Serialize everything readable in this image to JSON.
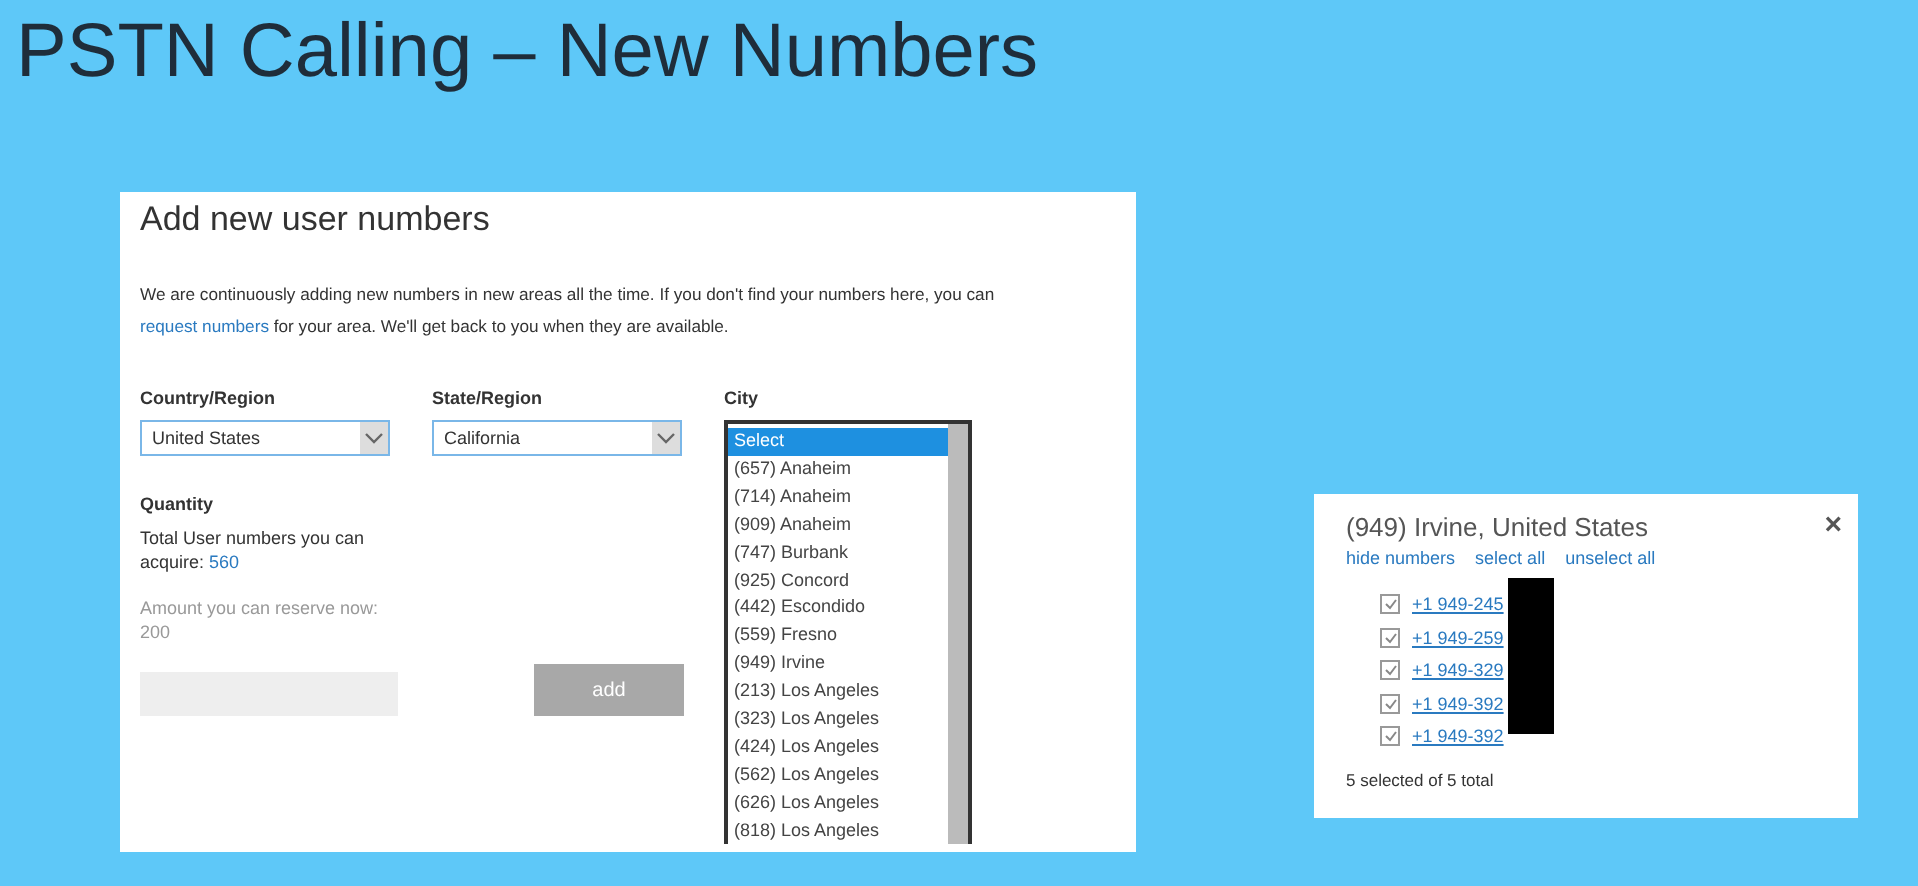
{
  "slide_title": "PSTN Calling – New Numbers",
  "add_panel": {
    "title": "Add new user numbers",
    "intro": {
      "before": "We are continuously adding new numbers in new areas all the time. If you don't find your numbers here, you can",
      "link": "request numbers",
      "after": "for your area. We'll get back to you when they are available."
    },
    "country": {
      "label": "Country/Region",
      "value": "United States"
    },
    "state": {
      "label": "State/Region",
      "value": "California"
    },
    "quantity": {
      "label": "Quantity",
      "total_label": "Total User numbers you can acquire:",
      "total_value": "560",
      "reserve": "Amount you can reserve now: 200",
      "add_button": "add",
      "add_disabled": true
    },
    "city": {
      "label": "City",
      "options": [
        {
          "label": "Select",
          "selected": true
        },
        {
          "label": "(657) Anaheim",
          "selected": false
        },
        {
          "label": "(714) Anaheim",
          "selected": false
        },
        {
          "label": "(909) Anaheim",
          "selected": false
        },
        {
          "label": "(747) Burbank",
          "selected": false
        },
        {
          "label": "(925) Concord",
          "selected": false
        },
        {
          "label": "(442) Escondido",
          "selected": false
        },
        {
          "label": "(559) Fresno",
          "selected": false
        },
        {
          "label": "(949) Irvine",
          "selected": false
        },
        {
          "label": "(213) Los Angeles",
          "selected": false
        },
        {
          "label": "(323) Los Angeles",
          "selected": false
        },
        {
          "label": "(424) Los Angeles",
          "selected": false
        },
        {
          "label": "(562) Los Angeles",
          "selected": false
        },
        {
          "label": "(626) Los Angeles",
          "selected": false
        },
        {
          "label": "(818) Los Angeles",
          "selected": false
        }
      ]
    }
  },
  "numbers_panel": {
    "title": "(949) Irvine, United States",
    "close": "×",
    "actions": [
      "hide numbers",
      "select all",
      "unselect all"
    ],
    "numbers": [
      {
        "number": "+1 949-245",
        "checked": true
      },
      {
        "number": "+1 949-259",
        "checked": true
      },
      {
        "number": "+1 949-329",
        "checked": true
      },
      {
        "number": "+1 949-392",
        "checked": true
      },
      {
        "number": "+1 949-392",
        "checked": true
      }
    ],
    "summary": "5 selected of 5 total"
  }
}
